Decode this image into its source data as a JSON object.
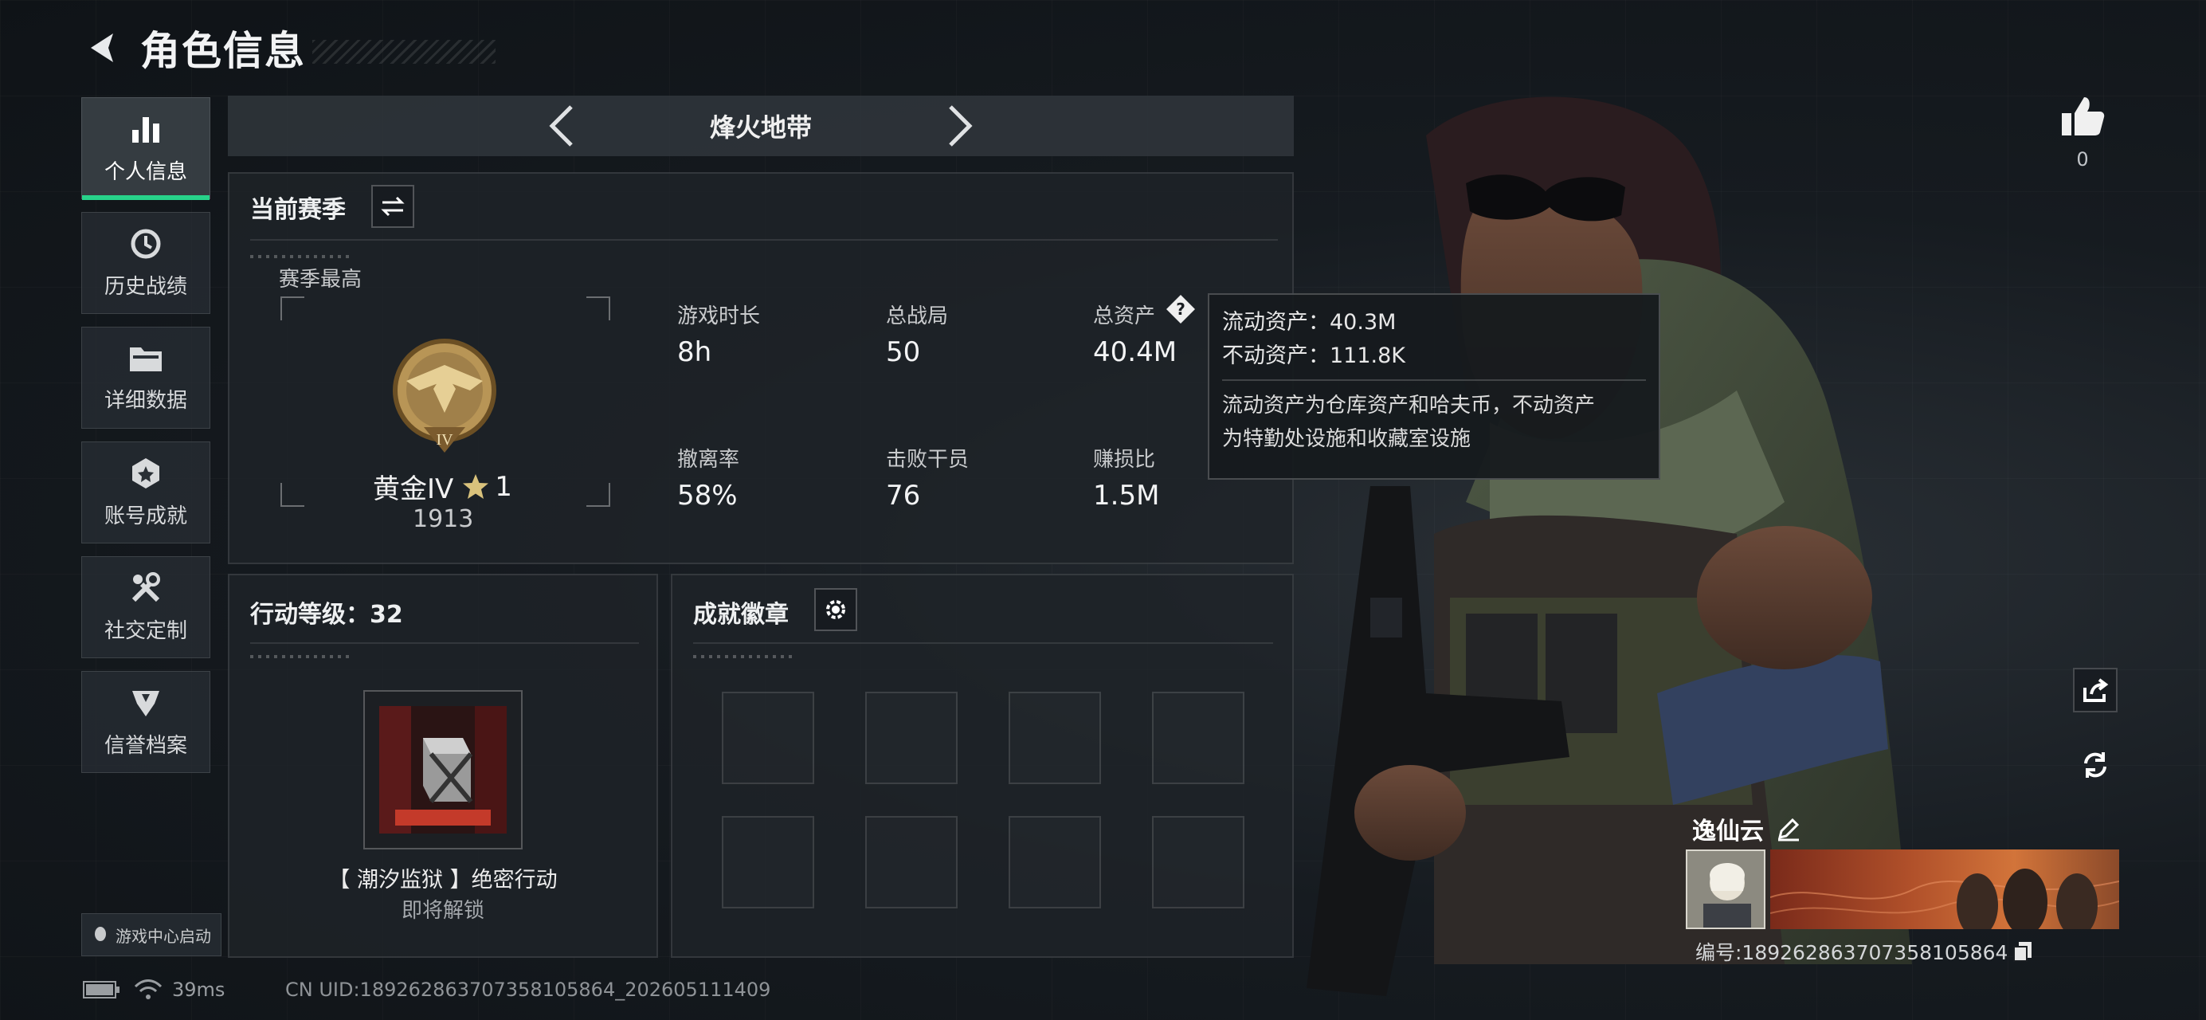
{
  "header": {
    "title": "角色信息"
  },
  "sidebar": {
    "items": [
      {
        "label": "个人信息",
        "icon": "bar-chart-icon",
        "active": true
      },
      {
        "label": "历史战绩",
        "icon": "clock-history-icon",
        "active": false
      },
      {
        "label": "详细数据",
        "icon": "folder-icon",
        "active": false
      },
      {
        "label": "账号成就",
        "icon": "achievement-icon",
        "active": false
      },
      {
        "label": "社交定制",
        "icon": "tools-icon",
        "active": false
      },
      {
        "label": "信誉档案",
        "icon": "shield-icon",
        "active": false
      }
    ],
    "launch_label": "游戏中心启动"
  },
  "mode": {
    "name": "烽火地带"
  },
  "season": {
    "title": "当前赛季",
    "best_label": "赛季最高",
    "rank_name": "黄金IV",
    "rank_stars": "1",
    "rank_score": "1913",
    "stats": [
      {
        "label": "游戏时长",
        "value": "8h"
      },
      {
        "label": "总战局",
        "value": "50"
      },
      {
        "label": "总资产",
        "value": "40.4M"
      },
      {
        "label": "撤离率",
        "value": "58%"
      },
      {
        "label": "击败干员",
        "value": "76"
      },
      {
        "label": "赚损比",
        "value": "1.5M"
      }
    ]
  },
  "tooltip": {
    "line1": "流动资产：40.3M",
    "line2": "不动资产：111.8K",
    "desc1": "流动资产为仓库资产和哈夫币，不动资产",
    "desc2": "为特勤处设施和收藏室设施"
  },
  "action_level": {
    "title": "行动等级：32",
    "name": "【 潮汐监狱 】绝密行动",
    "status": "即将解锁"
  },
  "badges": {
    "title": "成就徽章",
    "slots": 8
  },
  "right": {
    "like_count": "0",
    "player_name": "逸仙云",
    "player_id": "编号:1892628637073581058​64"
  },
  "footer": {
    "ping": "39ms",
    "uid": "CN UID:1892628637073581058​64_202605111409"
  },
  "colors": {
    "accent": "#27d28a",
    "gold": "#c9a45c"
  }
}
